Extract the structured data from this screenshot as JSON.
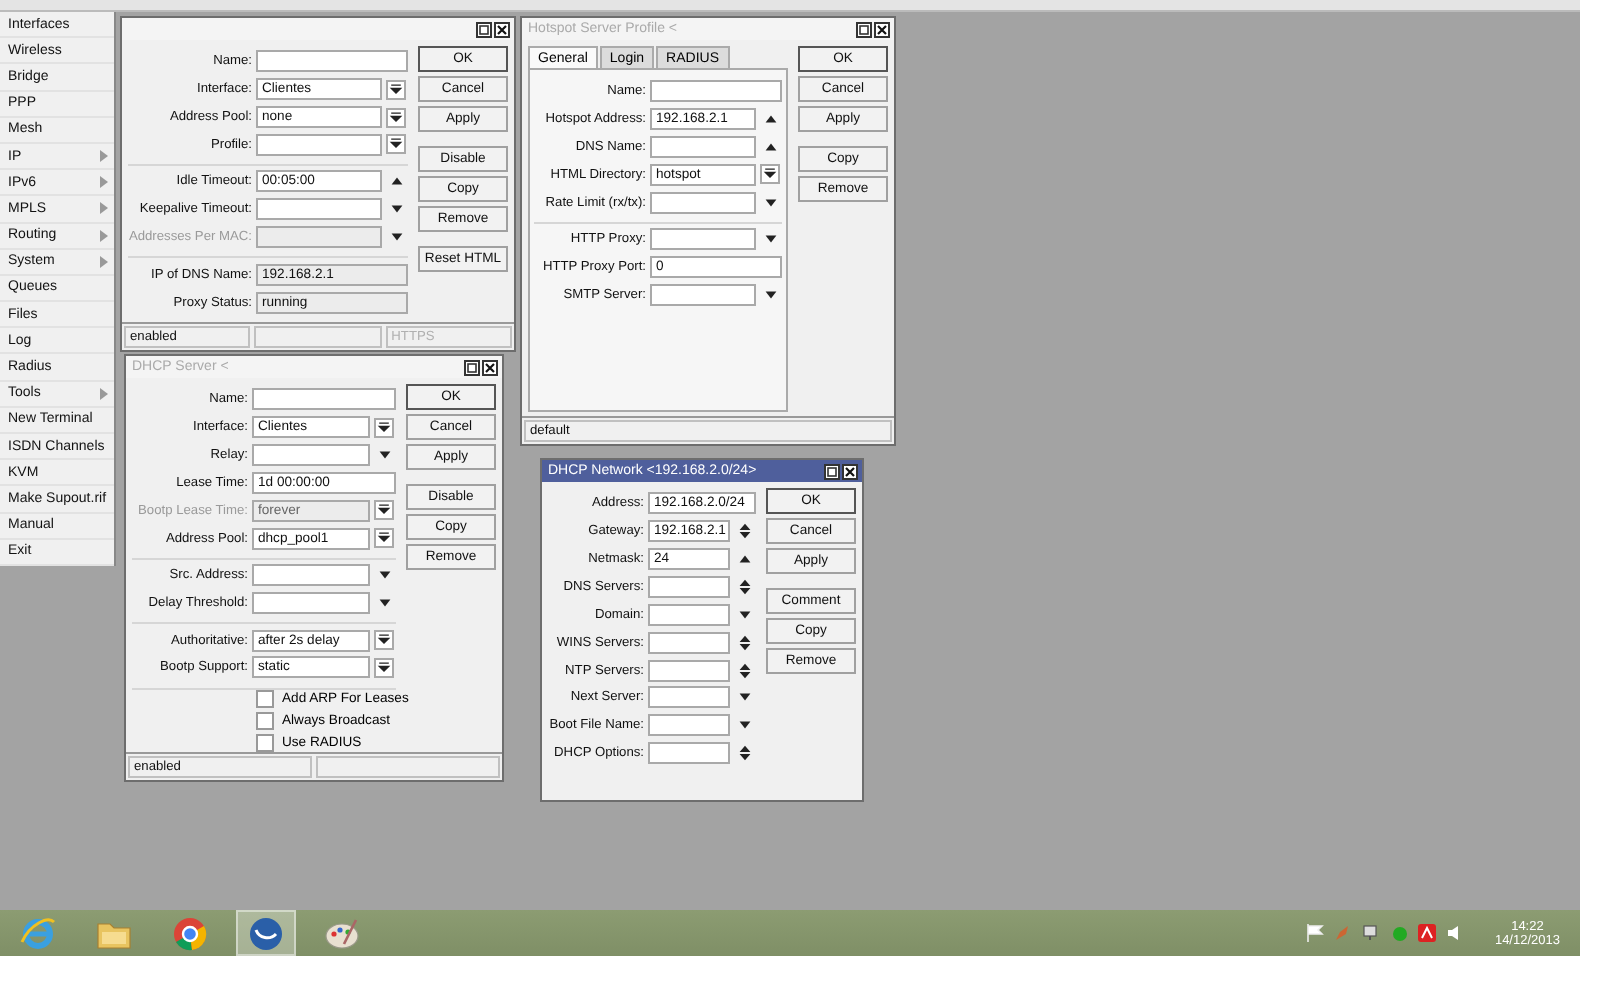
{
  "sidebar": {
    "items": [
      {
        "label": "Interfaces",
        "submenu": false
      },
      {
        "label": "Wireless",
        "submenu": false
      },
      {
        "label": "Bridge",
        "submenu": false
      },
      {
        "label": "PPP",
        "submenu": false
      },
      {
        "label": "Mesh",
        "submenu": false
      },
      {
        "label": "IP",
        "submenu": true
      },
      {
        "label": "IPv6",
        "submenu": true
      },
      {
        "label": "MPLS",
        "submenu": true
      },
      {
        "label": "Routing",
        "submenu": true
      },
      {
        "label": "System",
        "submenu": true
      },
      {
        "label": "Queues",
        "submenu": false
      },
      {
        "label": "Files",
        "submenu": false
      },
      {
        "label": "Log",
        "submenu": false
      },
      {
        "label": "Radius",
        "submenu": false
      },
      {
        "label": "Tools",
        "submenu": true
      },
      {
        "label": "New Terminal",
        "submenu": false
      },
      {
        "label": "ISDN Channels",
        "submenu": false
      },
      {
        "label": "KVM",
        "submenu": false
      },
      {
        "label": "Make Supout.rif",
        "submenu": false
      },
      {
        "label": "Manual",
        "submenu": false
      },
      {
        "label": "Exit",
        "submenu": false
      }
    ]
  },
  "windows": [
    {
      "active": false,
      "sections": [
        [
          {
            "label": "Name:",
            "kind": "text",
            "disabled": false
          },
          {
            "label": "Interface:",
            "value": "Clientes",
            "kind": "select",
            "disabled": false
          },
          {
            "label": "Address Pool:",
            "value": "none",
            "kind": "select",
            "disabled": false
          },
          {
            "label": "Profile:",
            "kind": "select",
            "disabled": false
          }
        ],
        [
          {
            "label": "Idle Timeout:",
            "value": "00:05:00",
            "kind": "up",
            "disabled": false
          },
          {
            "label": "Keepalive Timeout:",
            "kind": "down",
            "disabled": false
          },
          {
            "label": "Addresses Per MAC:",
            "kind": "down",
            "disabled": true
          }
        ],
        [
          {
            "label": "IP of DNS Name:",
            "value": "192.168.2.1",
            "kind": "readonly",
            "disabled": false
          },
          {
            "label": "Proxy Status:",
            "value": "running",
            "kind": "readonly",
            "disabled": false
          }
        ]
      ],
      "buttons": [
        [
          "OK",
          "Cancel",
          "Apply"
        ],
        [
          "Disable",
          "Copy",
          "Remove"
        ],
        [
          "Reset HTML"
        ]
      ],
      "status": [
        {
          "kind": "text",
          "text": "enabled",
          "disabled": false
        },
        {
          "kind": "blank"
        },
        {
          "kind": "text",
          "text": "HTTPS",
          "disabled": true
        }
      ]
    },
    {
      "title": "Hotspot Server Profile <",
      "active": false,
      "tabs": [
        {
          "label": "General",
          "selected": true
        },
        {
          "label": "Login",
          "selected": false
        },
        {
          "label": "RADIUS",
          "selected": false
        }
      ],
      "sections": [
        [
          {
            "label": "Name:",
            "kind": "text",
            "disabled": false
          },
          {
            "label": "Hotspot Address:",
            "value": "192.168.2.1",
            "kind": "up",
            "disabled": false
          },
          {
            "label": "DNS Name:",
            "kind": "up",
            "disabled": false
          },
          {
            "label": "HTML Directory:",
            "value": "hotspot",
            "kind": "select",
            "disabled": false
          },
          {
            "label": "Rate Limit (rx/tx):",
            "kind": "down",
            "disabled": false
          }
        ],
        [
          {
            "label": "HTTP Proxy:",
            "kind": "down",
            "disabled": false
          },
          {
            "label": "HTTP Proxy Port:",
            "value": "0",
            "kind": "text",
            "disabled": false
          },
          {
            "label": "SMTP Server:",
            "kind": "down",
            "disabled": false
          }
        ]
      ],
      "buttons": [
        [
          "OK",
          "Cancel",
          "Apply"
        ],
        [
          "Copy",
          "Remove"
        ]
      ],
      "status": [
        {
          "kind": "text",
          "text": "default",
          "disabled": false
        }
      ]
    },
    {
      "title": "DHCP Server <",
      "active": false,
      "sections": [
        [
          {
            "label": "Name:",
            "kind": "text",
            "disabled": false
          },
          {
            "label": "Interface:",
            "value": "Clientes",
            "kind": "select",
            "disabled": false
          },
          {
            "label": "Relay:",
            "kind": "down",
            "disabled": false
          },
          {
            "label": "Lease Time:",
            "value": "1d 00:00:00",
            "kind": "text",
            "disabled": false
          },
          {
            "label": "Bootp Lease Time:",
            "value": "forever",
            "kind": "select",
            "disabled": true
          },
          {
            "label": "Address Pool:",
            "value": "dhcp_pool1",
            "kind": "select",
            "disabled": false
          }
        ],
        [
          {
            "label": "Src. Address:",
            "kind": "down",
            "disabled": false
          },
          {
            "label": "Delay Threshold:",
            "kind": "down",
            "disabled": false
          }
        ],
        [
          {
            "label": "Authoritative:",
            "value": "after 2s delay",
            "kind": "select",
            "disabled": false
          },
          {
            "label": "Bootp Support:",
            "value": "static",
            "kind": "select",
            "disabled": false
          }
        ]
      ],
      "checkboxes": [
        {
          "label": "Add ARP For Leases",
          "checked": false
        },
        {
          "label": "Always Broadcast",
          "checked": false
        },
        {
          "label": "Use RADIUS",
          "checked": false
        }
      ],
      "buttons": [
        [
          "OK",
          "Cancel",
          "Apply"
        ],
        [
          "Disable",
          "Copy",
          "Remove"
        ]
      ],
      "status": [
        {
          "kind": "text",
          "text": "enabled",
          "disabled": false
        },
        {
          "kind": "blank"
        }
      ]
    },
    {
      "title": "DHCP Network <192.168.2.0/24>",
      "active": true,
      "sections": [
        [
          {
            "label": "Address:",
            "value": "192.168.2.0/24",
            "kind": "text",
            "disabled": false
          },
          {
            "label": "Gateway:",
            "value": "192.168.2.1",
            "kind": "updown",
            "disabled": false
          },
          {
            "label": "Netmask:",
            "value": "24",
            "kind": "up",
            "disabled": false
          },
          {
            "label": "DNS Servers:",
            "kind": "updown",
            "disabled": false
          },
          {
            "label": "Domain:",
            "kind": "down",
            "disabled": false
          },
          {
            "label": "WINS Servers:",
            "kind": "updown",
            "disabled": false
          },
          {
            "label": "NTP Servers:",
            "kind": "updown",
            "disabled": false
          },
          {
            "label": "Next Server:",
            "kind": "down",
            "disabled": false
          },
          {
            "label": "Boot File Name:",
            "kind": "down",
            "disabled": false
          },
          {
            "label": "DHCP Options:",
            "kind": "updown",
            "disabled": false
          }
        ]
      ],
      "buttons": [
        [
          "OK",
          "Cancel",
          "Apply"
        ],
        [
          "Comment",
          "Copy",
          "Remove"
        ]
      ]
    }
  ],
  "taskbar": {
    "apps": [
      {
        "kind": "ie",
        "selected": false
      },
      {
        "kind": "folder",
        "selected": false
      },
      {
        "kind": "chrome",
        "selected": false
      },
      {
        "kind": "winbox",
        "selected": true
      },
      {
        "kind": "paint",
        "selected": false
      }
    ],
    "time": "14:22",
    "date": "14/12/2013"
  }
}
